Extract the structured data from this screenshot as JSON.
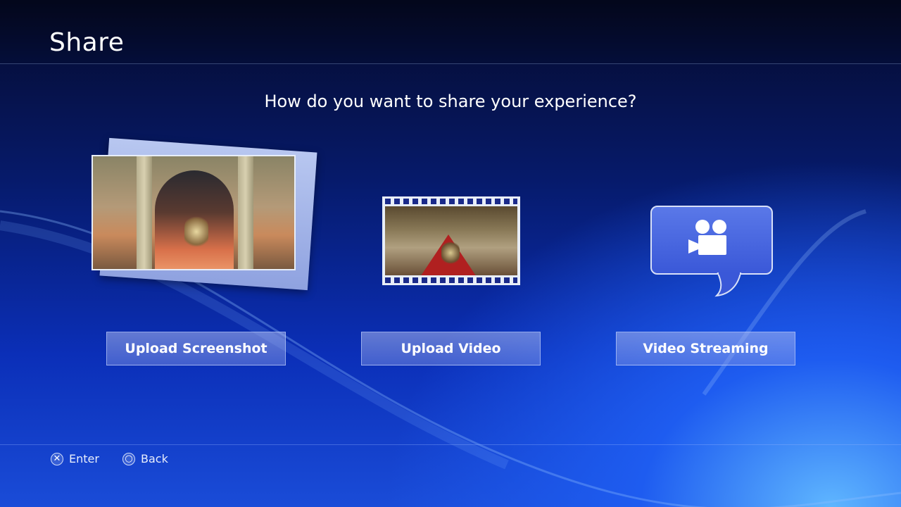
{
  "header": {
    "title": "Share"
  },
  "prompt": {
    "question": "How do you want to share your experience?"
  },
  "options": [
    {
      "label": "Upload Screenshot",
      "icon": "screenshot-stack-icon"
    },
    {
      "label": "Upload Video",
      "icon": "film-strip-icon"
    },
    {
      "label": "Video Streaming",
      "icon": "video-camera-speech-bubble-icon"
    }
  ],
  "footer": {
    "enter_label": "Enter",
    "back_label": "Back",
    "enter_icon": "cross-button-icon",
    "back_icon": "circle-button-icon"
  },
  "colors": {
    "background_dark": "#050a2a",
    "background_blue": "#0b2fb8",
    "accent_light": "#5fb6ff",
    "button_fill": "#8a9ee6"
  }
}
